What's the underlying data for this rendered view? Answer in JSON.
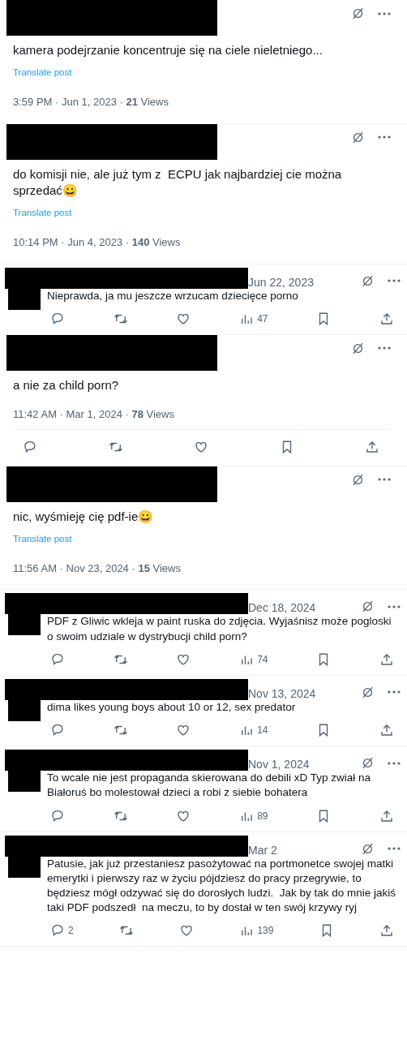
{
  "posts": [
    {
      "kind": "detail",
      "text": "kamera podejrzanie koncentruje się na ciele nieletniego...",
      "translate": "Translate post",
      "meta": "3:59 PM · Jun 1, 2023 · **21** Views"
    },
    {
      "kind": "detail",
      "text": "do komisji nie, ale już tym z  ECPU jak najbardziej cie można sprzedać😀",
      "translate": "Translate post",
      "meta": "10:14 PM · Jun 4, 2023 · **140** Views"
    },
    {
      "kind": "reply",
      "date": "Jun 22, 2023",
      "text": "Nieprawda, ja mu jeszcze wrzucam dziecięce porno",
      "actions": [
        {
          "kind": "reply"
        },
        {
          "kind": "repost"
        },
        {
          "kind": "like"
        },
        {
          "kind": "views",
          "count": "47"
        },
        {
          "kind": "bookmark"
        },
        {
          "kind": "share"
        }
      ]
    },
    {
      "kind": "detail",
      "text": "a nie za child porn?",
      "meta": "11:42 AM · Mar 1, 2024 · **78** Views",
      "actions": [
        {
          "kind": "reply"
        },
        {
          "kind": "repost"
        },
        {
          "kind": "like"
        },
        {
          "kind": "bookmark"
        },
        {
          "kind": "share"
        }
      ]
    },
    {
      "kind": "detail",
      "text": "nic, wyśmieję cię pdf-ie😀",
      "translate": "Translate post",
      "meta": "11:56 AM · Nov 23, 2024 · **15** Views"
    },
    {
      "kind": "reply",
      "date": "Dec 18, 2024",
      "text": "PDF z Gliwic wkleja w paint ruska do zdjęcia. Wyjaśnisz może pogloski o swoim udziale w dystrybucji child porn?",
      "actions": [
        {
          "kind": "reply"
        },
        {
          "kind": "repost"
        },
        {
          "kind": "like"
        },
        {
          "kind": "views",
          "count": "74"
        },
        {
          "kind": "bookmark"
        },
        {
          "kind": "share"
        }
      ]
    },
    {
      "kind": "reply",
      "date": "Nov 13, 2024",
      "text": "dima likes young boys about 10 or 12, sex predator",
      "actions": [
        {
          "kind": "reply"
        },
        {
          "kind": "repost"
        },
        {
          "kind": "like"
        },
        {
          "kind": "views",
          "count": "14"
        },
        {
          "kind": "bookmark"
        },
        {
          "kind": "share"
        }
      ]
    },
    {
      "kind": "reply",
      "date": "Nov 1, 2024",
      "text": "To wcale nie jest propaganda skierowana do debili xD Typ zwiał na Białoruś bo molestował dzieci a robi z siebie bohatera",
      "actions": [
        {
          "kind": "reply"
        },
        {
          "kind": "repost"
        },
        {
          "kind": "like"
        },
        {
          "kind": "views",
          "count": "89"
        },
        {
          "kind": "bookmark"
        },
        {
          "kind": "share"
        }
      ]
    },
    {
      "kind": "reply",
      "date": "Mar 2",
      "text": "Patusie, jak już przestaniesz pasożytować na portmonetce swojej matki emerytki i pierwszy raz w życiu pójdziesz do pracy przegrywie, to będziesz mógł odzywać się do dorosłych ludzi.  Jak by tak do mnie jakiś taki PDF podszedł  na meczu, to by dostał w ten swój krzywy ryj",
      "actions": [
        {
          "kind": "reply",
          "count": "2"
        },
        {
          "kind": "repost"
        },
        {
          "kind": "like"
        },
        {
          "kind": "views",
          "count": "139"
        },
        {
          "kind": "bookmark"
        },
        {
          "kind": "share"
        }
      ]
    }
  ]
}
